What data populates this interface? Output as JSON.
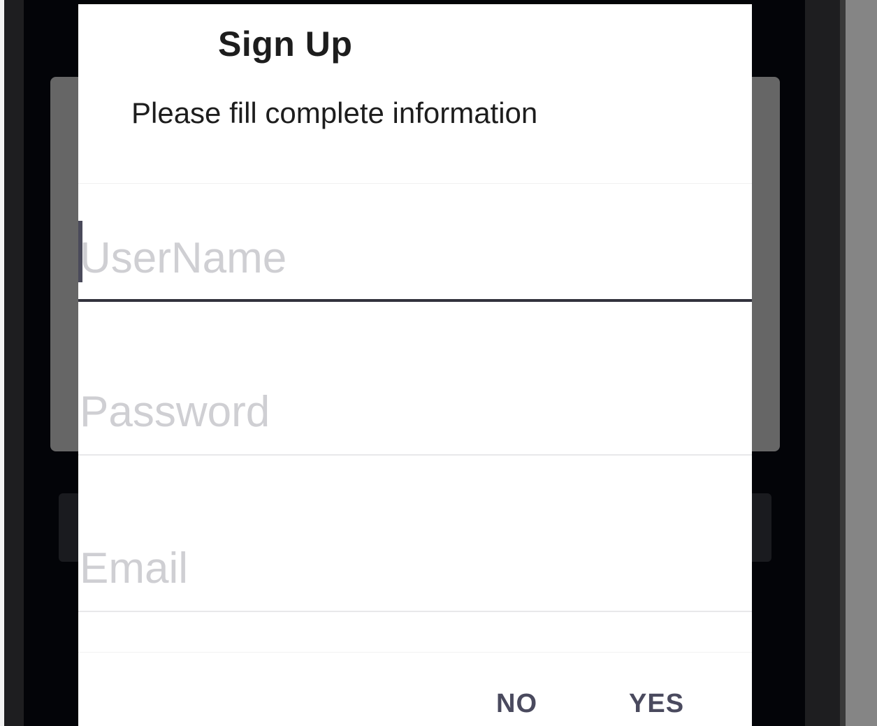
{
  "dialog": {
    "title": "Sign Up",
    "message": "Please fill complete information",
    "fields": {
      "username": {
        "placeholder": "UserName",
        "value": ""
      },
      "password": {
        "placeholder": "Password",
        "value": ""
      },
      "email": {
        "placeholder": "Email",
        "value": ""
      }
    },
    "buttons": {
      "no_label": "NO",
      "yes_label": "YES"
    }
  },
  "colors": {
    "dialog_background": "#ffffff",
    "scrim": "#030408",
    "text_primary": "#1d1d1d",
    "placeholder": "#cfcfd3",
    "active_underline": "#33333d",
    "button_text": "#4a4a5e"
  }
}
